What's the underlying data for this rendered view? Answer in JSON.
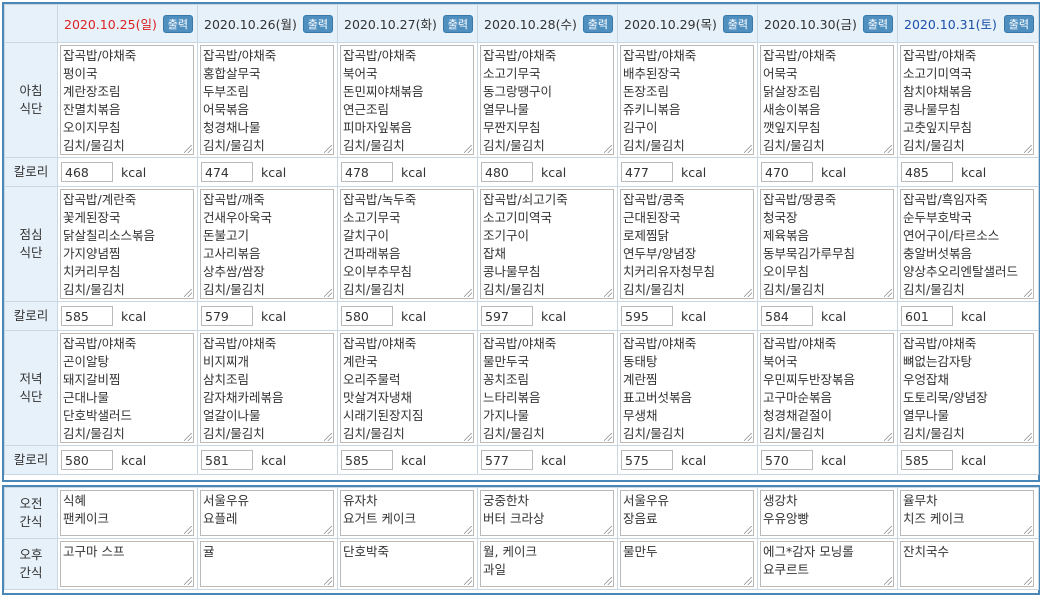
{
  "days": [
    {
      "date": "2020.10.25(일)",
      "kind": "sun"
    },
    {
      "date": "2020.10.26(월)",
      "kind": "wd"
    },
    {
      "date": "2020.10.27(화)",
      "kind": "wd"
    },
    {
      "date": "2020.10.28(수)",
      "kind": "wd"
    },
    {
      "date": "2020.10.29(목)",
      "kind": "wd"
    },
    {
      "date": "2020.10.30(금)",
      "kind": "wd"
    },
    {
      "date": "2020.10.31(토)",
      "kind": "sat"
    }
  ],
  "print_label": "출력",
  "calorie_label": "칼로리",
  "kcal_unit": "kcal",
  "meals": [
    {
      "label_line1": "아침",
      "label_line2": "식단",
      "menus": [
        [
          "잡곡밥/야채죽",
          "펑이국",
          "계란장조림",
          "잔멸치볶음",
          "오이지무침",
          "김치/물김치"
        ],
        [
          "잡곡밥/야채죽",
          "홍합살무국",
          "두부조림",
          "어묵볶음",
          "청경채나물",
          "김치/물김치"
        ],
        [
          "잡곡밥/야채죽",
          "북어국",
          "돈민찌야채볶음",
          "연근조림",
          "피마자잎볶음",
          "김치/물김치"
        ],
        [
          "잡곡밥/야채죽",
          "소고기무국",
          "동그랑땡구이",
          "열무나물",
          "무짠지무침",
          "김치/물김치"
        ],
        [
          "잡곡밥/야채죽",
          "배추된장국",
          "돈장조림",
          "쥬키니볶음",
          "김구이",
          "김치/물김치"
        ],
        [
          "잡곡밥/야채죽",
          "어묵국",
          "닭살장조림",
          "새송이볶음",
          "깻잎지무침",
          "김치/물김치"
        ],
        [
          "잡곡밥/야채죽",
          "소고기미역국",
          "참치야채볶음",
          "콩나물무침",
          "고춧잎지무침",
          "김치/물김치"
        ]
      ],
      "calories": [
        "468",
        "474",
        "478",
        "480",
        "477",
        "470",
        "485"
      ]
    },
    {
      "label_line1": "점심",
      "label_line2": "식단",
      "menus": [
        [
          "잡곡밥/계란죽",
          "꽃게된장국",
          "닭살칠리소스볶음",
          "가지양념찜",
          "치커리무침",
          "김치/물김치"
        ],
        [
          "잡곡밥/깨죽",
          "건새우아욱국",
          "돈불고기",
          "고사리볶음",
          "상추쌈/쌈장",
          "김치/물김치"
        ],
        [
          "잡곡밥/녹두죽",
          "소고기무국",
          "갈치구이",
          "건파래볶음",
          "오이부추무침",
          "김치/물김치"
        ],
        [
          "잡곡밥/쇠고기죽",
          "소고기미역국",
          "조기구이",
          "잡채",
          "콩나물무침",
          "김치/물김치"
        ],
        [
          "잡곡밥/콩죽",
          "근대된장국",
          "로제찜닭",
          "연두부/양념장",
          "치커리유자청무침",
          "김치/물김치"
        ],
        [
          "잡곡밥/땅콩죽",
          "청국장",
          "제육볶음",
          "동부묵김가루무침",
          "오이무침",
          "김치/물김치"
        ],
        [
          "잡곡밥/흑임자죽",
          "순두부호박국",
          "연어구이/타르소스",
          "충알버섯볶음",
          "양상추오리엔탈샐러드",
          "김치/물김치"
        ]
      ],
      "calories": [
        "585",
        "579",
        "580",
        "597",
        "595",
        "584",
        "601"
      ]
    },
    {
      "label_line1": "저녁",
      "label_line2": "식단",
      "menus": [
        [
          "잡곡밥/야채죽",
          "곤이알탕",
          "돼지갈비찜",
          "근대나물",
          "단호박샐러드",
          "김치/물김치"
        ],
        [
          "잡곡밥/야채죽",
          "비지찌개",
          "삼치조림",
          "감자채카레볶음",
          "얼갈이나물",
          "김치/물김치"
        ],
        [
          "잡곡밥/야채죽",
          "계란국",
          "오리주물럭",
          "맛살겨자냉채",
          "시래기된장지짐",
          "김치/물김치"
        ],
        [
          "잡곡밥/야채죽",
          "물만두국",
          "꽁치조림",
          "느타리볶음",
          "가지나물",
          "김치/물김치"
        ],
        [
          "잡곡밥/야채죽",
          "동태탕",
          "계란찜",
          "표고버섯볶음",
          "무생채",
          "김치/물김치"
        ],
        [
          "잡곡밥/야채죽",
          "북어국",
          "우민찌두반장볶음",
          "고구마순볶음",
          "청경채겉절이",
          "김치/물김치"
        ],
        [
          "잡곡밥/야채죽",
          "뼈없는감자탕",
          "우엉잡채",
          "도토리묵/양념장",
          "열무나물",
          "김치/물김치"
        ]
      ],
      "calories": [
        "580",
        "581",
        "585",
        "577",
        "575",
        "570",
        "585"
      ]
    }
  ],
  "snacks": [
    {
      "label_line1": "오전",
      "label_line2": "간식",
      "menus": [
        [
          "식혜",
          "팬케이크"
        ],
        [
          "서울우유",
          "요플레"
        ],
        [
          "유자차",
          "요거트 케이크"
        ],
        [
          "궁중한차",
          "버터 크라상"
        ],
        [
          "서울우유",
          "장음료"
        ],
        [
          "생강차",
          "우유앙빵"
        ],
        [
          "율무차",
          "치즈 케이크"
        ]
      ]
    },
    {
      "label_line1": "오후",
      "label_line2": "간식",
      "menus": [
        [
          "고구마 스프"
        ],
        [
          "귤"
        ],
        [
          "단호박죽"
        ],
        [
          "월, 케이크",
          "과일"
        ],
        [
          "물만두"
        ],
        [
          "에그*감자 모닝롤",
          "요쿠르트"
        ],
        [
          "잔치국수"
        ]
      ]
    }
  ]
}
